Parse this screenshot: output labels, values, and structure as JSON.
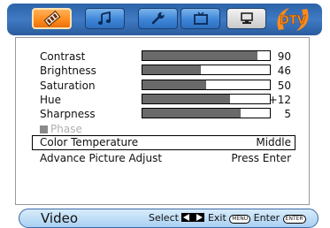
{
  "tabs": [
    {
      "name": "tab-video",
      "icon": "film-icon"
    },
    {
      "name": "tab-audio",
      "icon": "music-note-icon"
    },
    {
      "name": "tab-setup",
      "icon": "wrench-icon"
    },
    {
      "name": "tab-tv",
      "icon": "tv-icon"
    },
    {
      "name": "tab-pc",
      "icon": "monitor-icon"
    },
    {
      "name": "tab-dtv",
      "label": "DTV"
    }
  ],
  "menu": {
    "items": [
      {
        "label": "Contrast",
        "value": "90",
        "level": 0.9
      },
      {
        "label": "Brightness",
        "value": "46",
        "level": 0.46
      },
      {
        "label": "Saturation",
        "value": "50",
        "level": 0.5
      },
      {
        "label": "Hue",
        "value": "+12",
        "level": 0.69
      },
      {
        "label": "Sharpness",
        "value": "5",
        "level": 0.77
      }
    ],
    "phase_label": "Phase",
    "color_temperature": {
      "label": "Color Temperature",
      "value": "Middle"
    },
    "advance": {
      "label": "Advance Picture Adjust",
      "value": "Press Enter"
    }
  },
  "status": {
    "title": "Video",
    "select_label": "Select",
    "exit_label": "Exit",
    "menu_key": "MENU",
    "enter_label": "Enter",
    "enter_key": "ENTER"
  },
  "colors": {
    "accent": "#ff8a1c",
    "tabbar": "#2c63a8",
    "status_bg": "#a9d0f3"
  }
}
